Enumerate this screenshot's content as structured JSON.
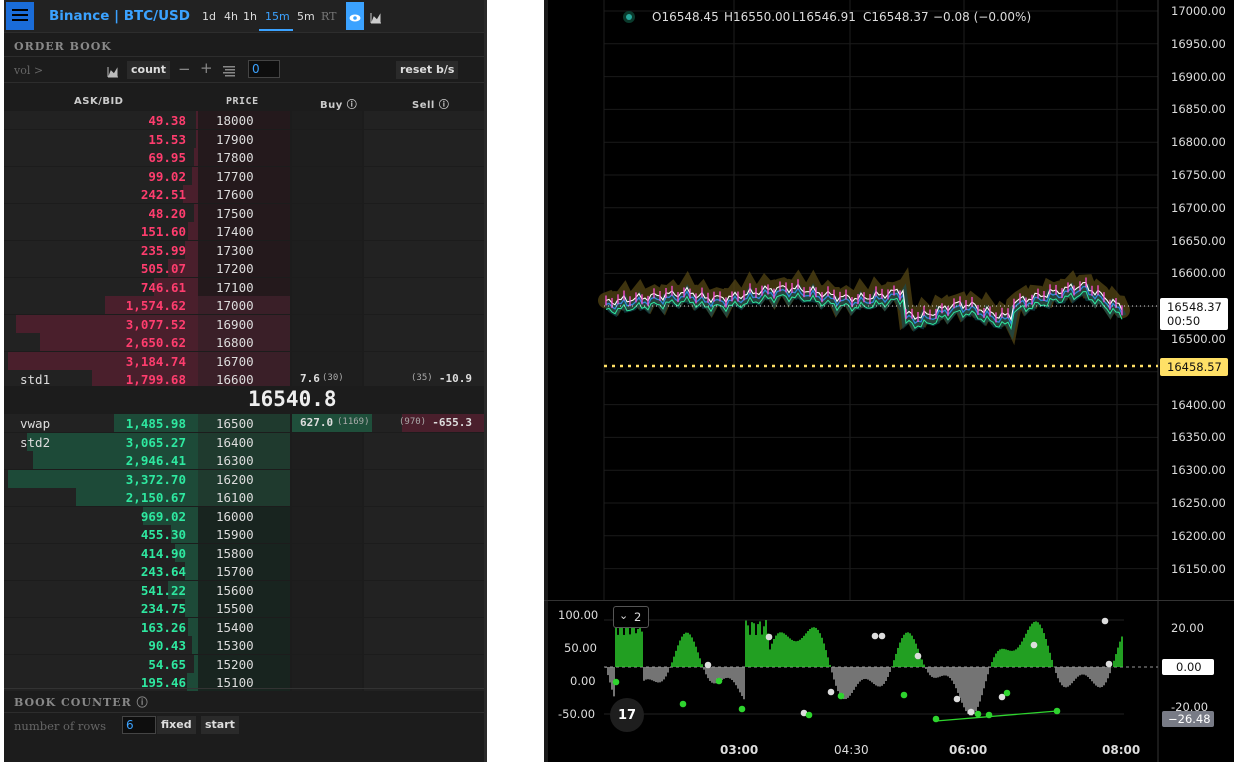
{
  "header": {
    "exchange_label": "Binance | BTC/USD",
    "timeframes": [
      "1d",
      "4h",
      "1h",
      "15m",
      "5m",
      "RT"
    ],
    "active_timeframe": "15m"
  },
  "order_book": {
    "title": "ORDER BOOK",
    "vol_label": "vol >",
    "count_label": "count",
    "count_value": "0",
    "reset_label": "reset b/s",
    "columns": [
      "ASK/BID",
      "PRICE",
      "Buy",
      "Sell"
    ],
    "asks": [
      {
        "amount": "49.38",
        "price": "18000",
        "depth": 0.01
      },
      {
        "amount": "15.53",
        "price": "17900",
        "depth": 0.01
      },
      {
        "amount": "69.95",
        "price": "17800",
        "depth": 0.02
      },
      {
        "amount": "99.02",
        "price": "17700",
        "depth": 0.03
      },
      {
        "amount": "242.51",
        "price": "17600",
        "depth": 0.08
      },
      {
        "amount": "48.20",
        "price": "17500",
        "depth": 0.02
      },
      {
        "amount": "151.60",
        "price": "17400",
        "depth": 0.05
      },
      {
        "amount": "235.99",
        "price": "17300",
        "depth": 0.07
      },
      {
        "amount": "505.07",
        "price": "17200",
        "depth": 0.16
      },
      {
        "amount": "746.61",
        "price": "17100",
        "depth": 0.23
      },
      {
        "amount": "1,574.62",
        "price": "17000",
        "depth": 0.49,
        "zone": true
      },
      {
        "amount": "3,077.52",
        "price": "16900",
        "depth": 0.96,
        "zone": true
      },
      {
        "amount": "2,650.62",
        "price": "16800",
        "depth": 0.83,
        "zone": true
      },
      {
        "amount": "3,184.74",
        "price": "16700",
        "depth": 1.0,
        "zone": true
      },
      {
        "amount": "1,799.68",
        "price": "16600",
        "depth": 0.56,
        "label": "std1",
        "zone": true,
        "buy": "7.6",
        "buy_count": "(30)",
        "sell": "-10.9",
        "sell_count": "(35)"
      }
    ],
    "mid_price": "16540.8",
    "bids": [
      {
        "amount": "1,485.98",
        "price": "16500",
        "depth": 0.44,
        "label": "vwap",
        "zone": true,
        "buy": "627.0",
        "buy_count": "(1169)",
        "sell": "-655.3",
        "sell_count": "(970)"
      },
      {
        "amount": "3,065.27",
        "price": "16400",
        "depth": 0.9,
        "label": "std2",
        "zone": true
      },
      {
        "amount": "2,946.41",
        "price": "16300",
        "depth": 0.87,
        "zone": true
      },
      {
        "amount": "3,372.70",
        "price": "16200",
        "depth": 1.0,
        "zone": true
      },
      {
        "amount": "2,150.67",
        "price": "16100",
        "depth": 0.64,
        "zone": true
      },
      {
        "amount": "969.02",
        "price": "16000",
        "depth": 0.29
      },
      {
        "amount": "455.30",
        "price": "15900",
        "depth": 0.14
      },
      {
        "amount": "414.90",
        "price": "15800",
        "depth": 0.12
      },
      {
        "amount": "243.64",
        "price": "15700",
        "depth": 0.07
      },
      {
        "amount": "541.22",
        "price": "15600",
        "depth": 0.16
      },
      {
        "amount": "234.75",
        "price": "15500",
        "depth": 0.07
      },
      {
        "amount": "163.26",
        "price": "15400",
        "depth": 0.05
      },
      {
        "amount": "90.43",
        "price": "15300",
        "depth": 0.03
      },
      {
        "amount": "54.65",
        "price": "15200",
        "depth": 0.02
      },
      {
        "amount": "195.46",
        "price": "15100",
        "depth": 0.06
      }
    ]
  },
  "book_counter": {
    "title": "BOOK COUNTER",
    "rows_label": "number of rows",
    "rows_value": "6",
    "fixed_label": "fixed",
    "start_label": "start"
  },
  "chart": {
    "ohlc": {
      "o": "O16548.45",
      "h": "H16550.00",
      "l": "L16546.91",
      "c": "C16548.37",
      "chg": "−0.08 (−0.00%)"
    },
    "price_axis": [
      "17000.00",
      "16950.00",
      "16900.00",
      "16850.00",
      "16800.00",
      "16750.00",
      "16700.00",
      "16650.00",
      "16600.00",
      "16550.00",
      "16500.00",
      "16450.00",
      "16400.00",
      "16350.00",
      "16300.00",
      "16250.00",
      "16200.00",
      "16150.00"
    ],
    "last_price_label": "16548.37",
    "countdown": "00:50",
    "line_price_label": "16458.57",
    "time_axis": [
      "03:00",
      "04:30",
      "06:00",
      "08:00"
    ],
    "osc_left_axis": [
      "100.00",
      "50.00",
      "0.00",
      "-50.00"
    ],
    "osc_right_axis": [
      "20.00",
      "-20.00"
    ],
    "osc_zero_label": "0.00",
    "osc_value_label": "−26.48",
    "osc_count": "2",
    "colors": {
      "ask": "#ff3d6e",
      "bid": "#2ee8a0",
      "accent": "#3ba2ff",
      "line_level": "#ffe066"
    }
  }
}
